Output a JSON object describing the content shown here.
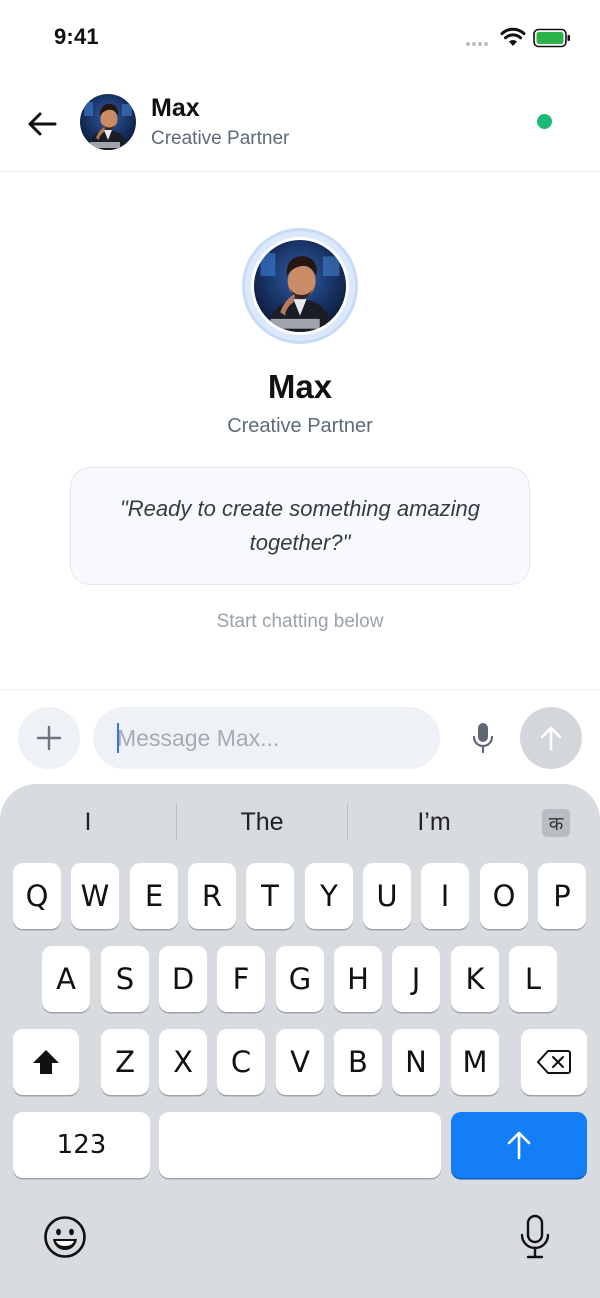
{
  "status": {
    "time": "9:41"
  },
  "header": {
    "name": "Max",
    "subtitle": "Creative Partner",
    "online_color": "#1db97a"
  },
  "intro": {
    "name": "Max",
    "subtitle": "Creative Partner",
    "quote": "\"Ready to create something amazing together?\"",
    "hint": "Start chatting below"
  },
  "composer": {
    "placeholder": "Message Max...",
    "accent": "#3a6ff0"
  },
  "keyboard": {
    "suggestions": [
      "I",
      "The",
      "I’m"
    ],
    "lang_key": "क",
    "row1": [
      "Q",
      "W",
      "E",
      "R",
      "T",
      "Y",
      "U",
      "I",
      "O",
      "P"
    ],
    "row2": [
      "A",
      "S",
      "D",
      "F",
      "G",
      "H",
      "J",
      "K",
      "L"
    ],
    "row3": [
      "Z",
      "X",
      "C",
      "V",
      "B",
      "N",
      "M"
    ],
    "numbers_key": "123",
    "return_color": "#137ef5",
    "icons": [
      "shift-icon",
      "backspace-icon",
      "return-arrow-icon",
      "emoji-icon",
      "dictation-mic-icon"
    ]
  }
}
